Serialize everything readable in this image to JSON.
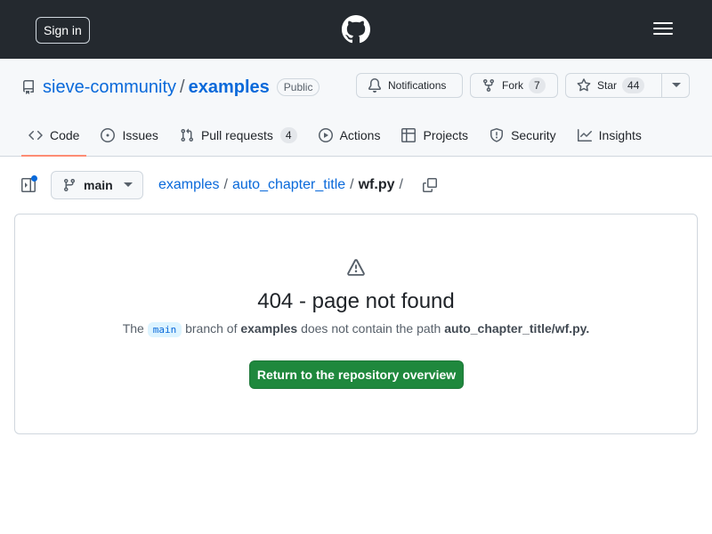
{
  "header": {
    "signin_label": "Sign in",
    "logo_icon": "github-logo-icon",
    "menu_icon": "hamburger-menu-icon",
    "background": "#24292f"
  },
  "repo": {
    "owner": "sieve-community",
    "separator": "/",
    "name": "examples",
    "visibility": "Public",
    "notifications_label": "Notifications",
    "fork_label": "Fork",
    "fork_count": "7",
    "star_label": "Star",
    "star_count": "44"
  },
  "tabs": [
    {
      "label": "Code",
      "icon": "code-icon",
      "active": true
    },
    {
      "label": "Issues",
      "icon": "issue-icon"
    },
    {
      "label": "Pull requests",
      "icon": "pull-request-icon",
      "count": "4"
    },
    {
      "label": "Actions",
      "icon": "play-icon"
    },
    {
      "label": "Projects",
      "icon": "table-icon"
    },
    {
      "label": "Security",
      "icon": "shield-icon"
    },
    {
      "label": "Insights",
      "icon": "graph-icon"
    }
  ],
  "filenav": {
    "branch": "main",
    "crumbs": [
      "examples",
      "auto_chapter_title"
    ],
    "file": "wf.py",
    "sep": "/"
  },
  "notfound": {
    "title": "404 - page not found",
    "desc_the": "The",
    "branch": "main",
    "desc_branch_of": "branch of",
    "repo": "examples",
    "desc_contain": "does not contain the path",
    "path": "auto_chapter_title/wf.py.",
    "button_label": "Return to the repository overview"
  },
  "colors": {
    "link": "#0969da",
    "accent_underline": "#fd8c73",
    "primary_button": "#1f883d"
  }
}
